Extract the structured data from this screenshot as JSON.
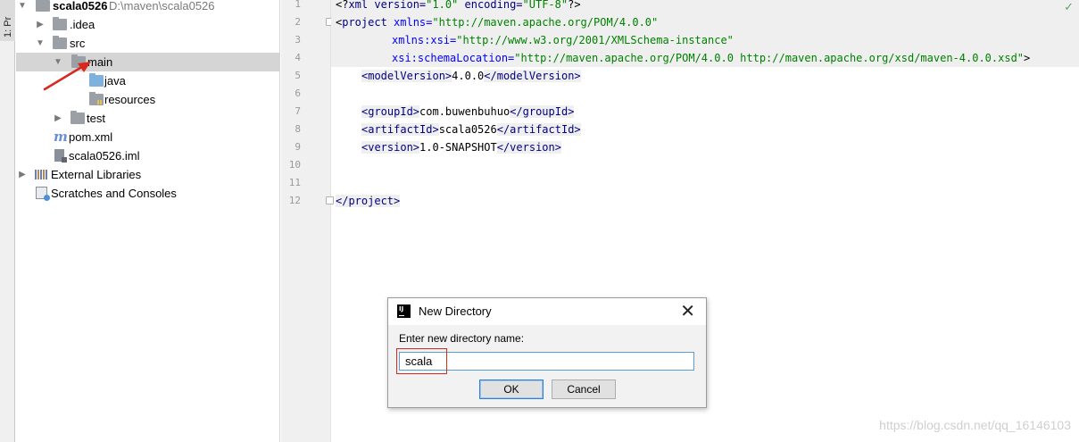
{
  "toolstrip": {
    "tab_label": "1: Pr"
  },
  "tree": {
    "root": {
      "name": "scala0526",
      "path": "D:\\maven\\scala0526",
      "arrow": "chevron-down"
    },
    "items": [
      {
        "label": ".idea",
        "icon": "folder-icon",
        "arrow": "chevron-right"
      },
      {
        "label": "src",
        "icon": "folder-icon",
        "arrow": "chevron-down"
      },
      {
        "label": "main",
        "icon": "folder-icon",
        "arrow": "chevron-down",
        "selected": true
      },
      {
        "label": "java",
        "icon": "source-folder-icon"
      },
      {
        "label": "resources",
        "icon": "resources-folder-icon"
      },
      {
        "label": "test",
        "icon": "folder-icon",
        "arrow": "chevron-right"
      },
      {
        "label": "pom.xml",
        "icon": "maven-icon"
      },
      {
        "label": "scala0526.iml",
        "icon": "iml-file-icon"
      },
      {
        "label": "External Libraries",
        "icon": "libraries-icon",
        "arrow": "chevron-right"
      },
      {
        "label": "Scratches and Consoles",
        "icon": "scratches-icon"
      }
    ]
  },
  "editor": {
    "line_numbers": [
      "1",
      "2",
      "3",
      "4",
      "5",
      "6",
      "7",
      "8",
      "9",
      "10",
      "11",
      "12"
    ],
    "line1": {
      "a": "<?",
      "b": "xml version=",
      "c": "\"1.0\"",
      "d": " encoding=",
      "e": "\"UTF-8\"",
      "f": "?>"
    },
    "line2": {
      "a": "<",
      "b": "project ",
      "c": "xmlns=",
      "d": "\"http://maven.apache.org/POM/4.0.0\""
    },
    "line3": {
      "a": "xmlns:xsi=",
      "b": "\"http://www.w3.org/2001/XMLSchema-instance\""
    },
    "line4": {
      "a": "xsi:schemaLocation=",
      "b": "\"http://maven.apache.org/POM/4.0.0 http://maven.apache.org/xsd/maven-4.0.0.xsd\"",
      "c": ">"
    },
    "line5": {
      "open": "<modelVersion>",
      "text": "4.0.0",
      "close": "</modelVersion>"
    },
    "line7": {
      "open": "<groupId>",
      "text": "com.buwenbuhuo",
      "close": "</groupId>"
    },
    "line8": {
      "open": "<artifactId>",
      "text": "scala0526",
      "close": "</artifactId>"
    },
    "line9": {
      "open": "<version>",
      "text": "1.0-SNAPSHOT",
      "close": "</version>"
    },
    "line12": {
      "close": "</project>"
    }
  },
  "dialog": {
    "app_icon_text": "IJ",
    "title": "New Directory",
    "close_glyph": "✕",
    "prompt": "Enter new directory name:",
    "input_value": "scala",
    "ok_label": "OK",
    "cancel_label": "Cancel"
  },
  "watermark": "https://blog.csdn.net/qq_16146103",
  "colors": {
    "tag": "#000080",
    "attr": "#0000ff",
    "value": "#008000",
    "selection": "#d5d5d5",
    "accent": "#2f7ed8",
    "annotation": "#d9281e"
  }
}
